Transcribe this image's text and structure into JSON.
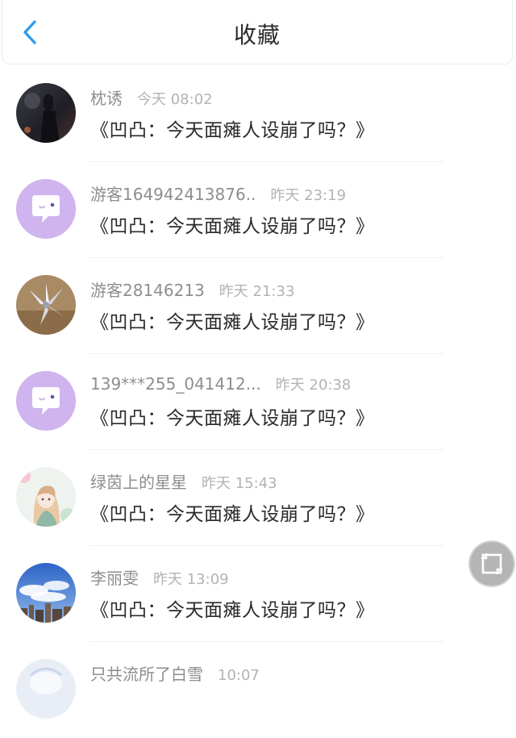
{
  "header": {
    "title": "收藏",
    "back_icon": "chevron-left-icon",
    "accent_color": "#2d9cf0"
  },
  "items": [
    {
      "name": "枕诱",
      "time": "今天 08:02",
      "message": "《凹凸：今天面瘫人设崩了吗？》",
      "avatar": "dark-photo"
    },
    {
      "name": "游客164942413876..",
      "time": "昨天 23:19",
      "message": "《凹凸：今天面瘫人设崩了吗？》",
      "avatar": "default-chat-bubble"
    },
    {
      "name": "游客28146213",
      "time": "昨天 21:33",
      "message": "《凹凸：今天面瘫人设崩了吗？》",
      "avatar": "origami-flower-photo"
    },
    {
      "name": "139***255_041412...",
      "time": "昨天 20:38",
      "message": "《凹凸：今天面瘫人设崩了吗？》",
      "avatar": "default-chat-bubble"
    },
    {
      "name": "绿茵上的星星",
      "time": "昨天 15:43",
      "message": "《凹凸：今天面瘫人设崩了吗？》",
      "avatar": "anime-girl-illustration"
    },
    {
      "name": "李丽雯",
      "time": "昨天 13:09",
      "message": "《凹凸：今天面瘫人设崩了吗？》",
      "avatar": "sky-city-photo"
    },
    {
      "name": "只共流所了白雪",
      "time": "10:07",
      "message": "",
      "avatar": "light-illustration"
    }
  ],
  "floating_button": {
    "icon": "screenshot-crop-icon"
  }
}
